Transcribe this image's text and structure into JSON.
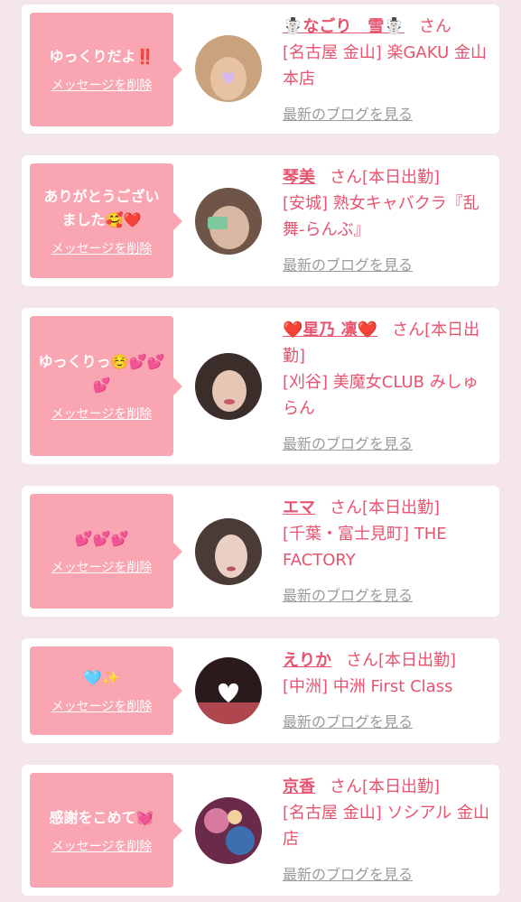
{
  "cards": [
    {
      "message": "ゆっくりだよ‼️",
      "delete_label": "メッセージを削除",
      "name": "☃️なごり　雪☃️",
      "suffix": "さん",
      "shop": "[名古屋 金山] 楽GAKU 金山本店",
      "blog_label": "最新のブログを見る",
      "avatar_colors": [
        "#c9a27e",
        "#e8c3a3"
      ]
    },
    {
      "message": "ありがとうございました🥰❤️",
      "delete_label": "メッセージを削除",
      "name": "琴美",
      "suffix": "さん[本日出勤]",
      "shop": "[安城] 熟女キャバクラ『乱舞-らんぶ』",
      "blog_label": "最新のブログを見る",
      "avatar_colors": [
        "#6e5547",
        "#d9b8a3"
      ]
    },
    {
      "message": "ゆっくりっ☺️💕💕💕",
      "delete_label": "メッセージを削除",
      "name": "❤️星乃 凛❤️",
      "suffix": "さん[本日出勤]",
      "shop": "[刈谷] 美魔女CLUB みしゅらん",
      "blog_label": "最新のブログを見る",
      "avatar_colors": [
        "#3a2d2a",
        "#e6c7b5"
      ]
    },
    {
      "message": "💕💕💕",
      "delete_label": "メッセージを削除",
      "name": "エマ",
      "suffix": "さん[本日出勤]",
      "shop": "[千葉・富士見町] THE FACTORY",
      "blog_label": "最新のブログを見る",
      "avatar_colors": [
        "#4a3b36",
        "#e9cfc4"
      ]
    },
    {
      "message": "🩵✨",
      "delete_label": "メッセージを削除",
      "name": "えりか",
      "suffix": "さん[本日出勤]",
      "shop": "[中洲] 中洲 First Class",
      "blog_label": "最新のブログを見る",
      "avatar_colors": [
        "#2a1a1c",
        "#b0464e"
      ]
    },
    {
      "message": "感謝をこめて💓",
      "delete_label": "メッセージを削除",
      "name": "京香",
      "suffix": "さん[本日出勤]",
      "shop": "[名古屋 金山] ソシアル 金山店",
      "blog_label": "最新のブログを見る",
      "avatar_colors": [
        "#6a2a4a",
        "#d87aa0"
      ]
    }
  ]
}
